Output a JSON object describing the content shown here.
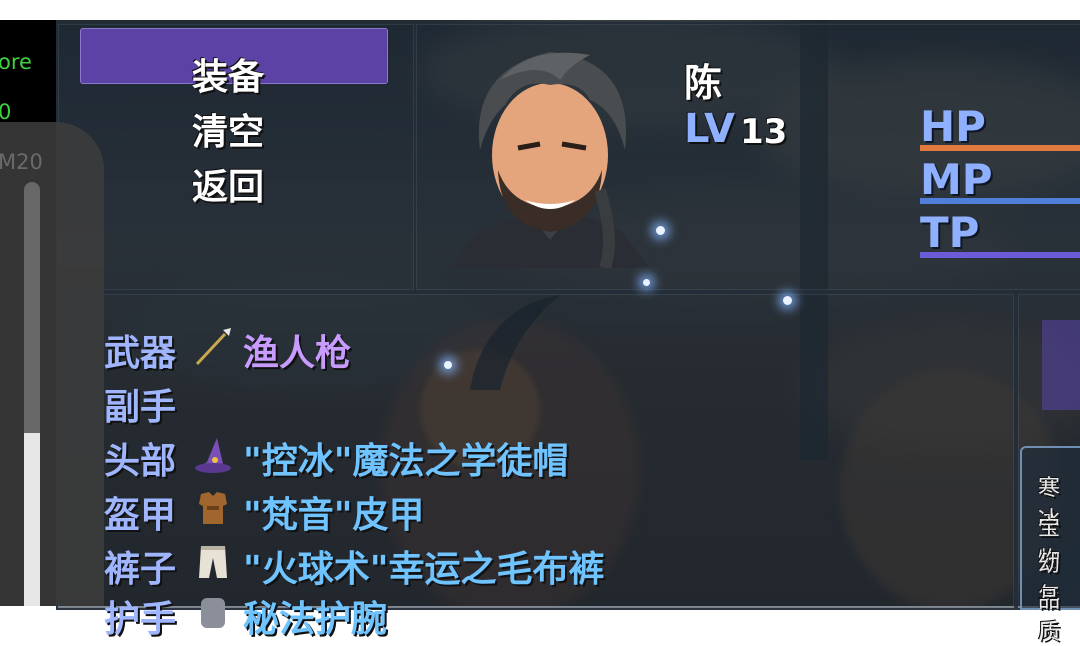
{
  "colors": {
    "accent": "#5d42a6",
    "hp": "#e27a3f",
    "mp": "#4f7fd8",
    "tp": "#6b5bd6",
    "equip_name": "#c89bff",
    "equip_item": "#6fc3ff",
    "status_green": "#3fd13f"
  },
  "side": {
    "line1": "ore",
    "line2": "0",
    "line3": "M20"
  },
  "menu": {
    "equip": "装备",
    "clear": "清空",
    "back": "返回"
  },
  "actor": {
    "name": "陈",
    "level_label": "LV",
    "level": "13"
  },
  "stats": {
    "hp": "HP",
    "mp": "MP",
    "tp": "TP"
  },
  "slots": [
    {
      "name": "武器",
      "item": "渔人枪",
      "icon": "spear-icon",
      "color": "#c89bff"
    },
    {
      "name": "副手",
      "item": "",
      "icon": "",
      "color": ""
    },
    {
      "name": "头部",
      "item": "\"控冰\"魔法之学徒帽",
      "icon": "wizard-hat-icon",
      "color": "#6fc3ff"
    },
    {
      "name": "盔甲",
      "item": "\"梵音\"皮甲",
      "icon": "leather-armor-icon",
      "color": "#6fc3ff"
    },
    {
      "name": "裤子",
      "item": "\"火球术\"幸运之毛布裤",
      "icon": "cloth-pants-icon",
      "color": "#6fc3ff"
    },
    {
      "name": "护手",
      "item": "秘法护腕",
      "icon": "bracer-icon",
      "color": "#6fc3ff"
    }
  ],
  "help": {
    "line1": "寒冰",
    "line2": "宝物",
    "line3": "幼年",
    "line4": "品质"
  }
}
